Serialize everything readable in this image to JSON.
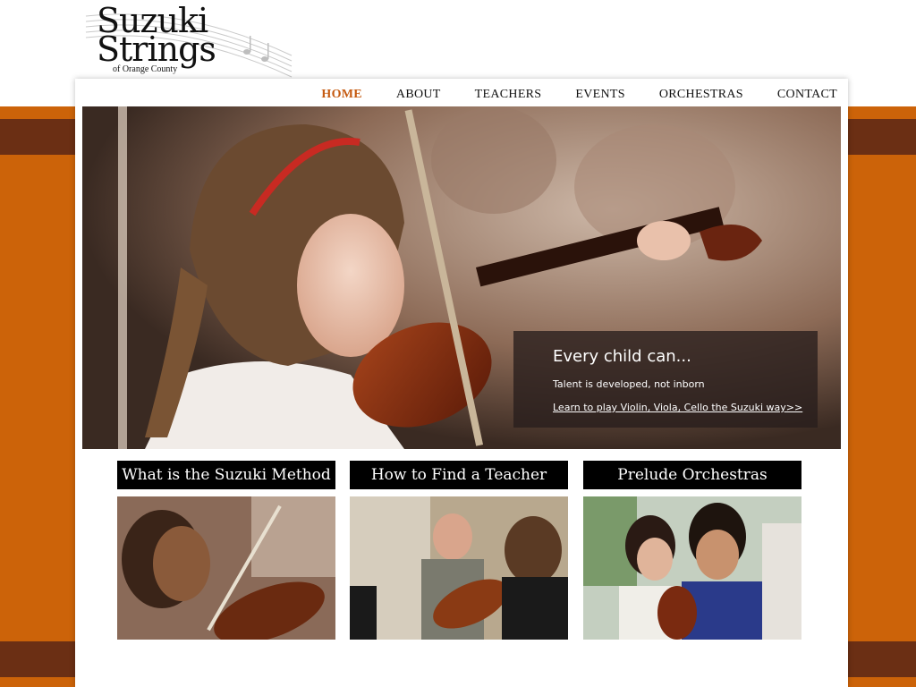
{
  "logo": {
    "line1": "Suzuki",
    "line2": "Strings",
    "line3": "of Orange County"
  },
  "nav": {
    "items": [
      "HOME",
      "ABOUT",
      "TEACHERS",
      "EVENTS",
      "ORCHESTRAS",
      "CONTACT"
    ],
    "active": "HOME"
  },
  "hero": {
    "headline": "Every child can...",
    "subline": "Talent is developed, not inborn",
    "link": "Learn to play Violin, Viola, Cello the Suzuki way>>"
  },
  "features": [
    {
      "title": "What is the Suzuki Method"
    },
    {
      "title": "How to Find a Teacher"
    },
    {
      "title": "Prelude Orchestras"
    }
  ],
  "colors": {
    "accent_orange": "#cc6309",
    "accent_brown": "#6b2f14",
    "nav_active": "#c55a10"
  }
}
